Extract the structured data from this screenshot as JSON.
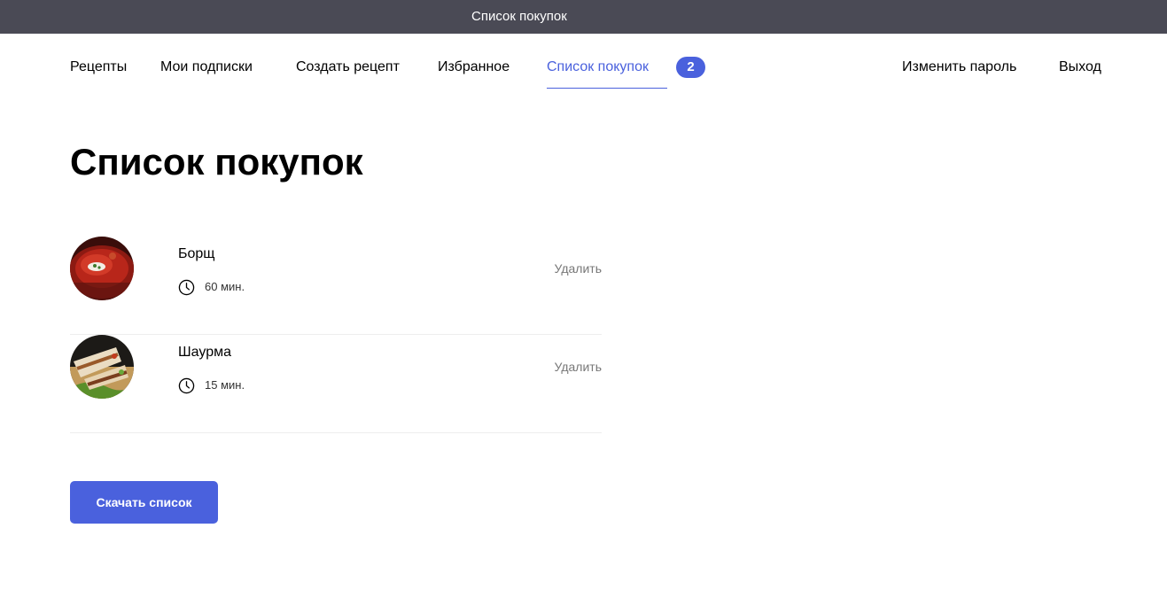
{
  "window": {
    "title": "Список покупок"
  },
  "nav": {
    "links": [
      {
        "label": "Рецепты"
      },
      {
        "label": "Мои подписки"
      },
      {
        "label": "Создать рецепт"
      },
      {
        "label": "Избранное"
      },
      {
        "label": "Список покупок",
        "active": true
      }
    ],
    "cart_count": "2",
    "right_links": [
      {
        "label": "Изменить пароль"
      },
      {
        "label": "Выход"
      }
    ]
  },
  "main": {
    "title": "Список покупок",
    "items": [
      {
        "name": "Борщ",
        "time": "60 мин.",
        "remove_label": "Удалить",
        "image_icon": "borscht-photo"
      },
      {
        "name": "Шаурма",
        "time": "15 мин.",
        "remove_label": "Удалить",
        "image_icon": "shawarma-photo"
      }
    ],
    "download_label": "Скачать список"
  },
  "colors": {
    "accent": "#4a61dd",
    "topbar": "#4a4a55",
    "muted": "#777777"
  }
}
